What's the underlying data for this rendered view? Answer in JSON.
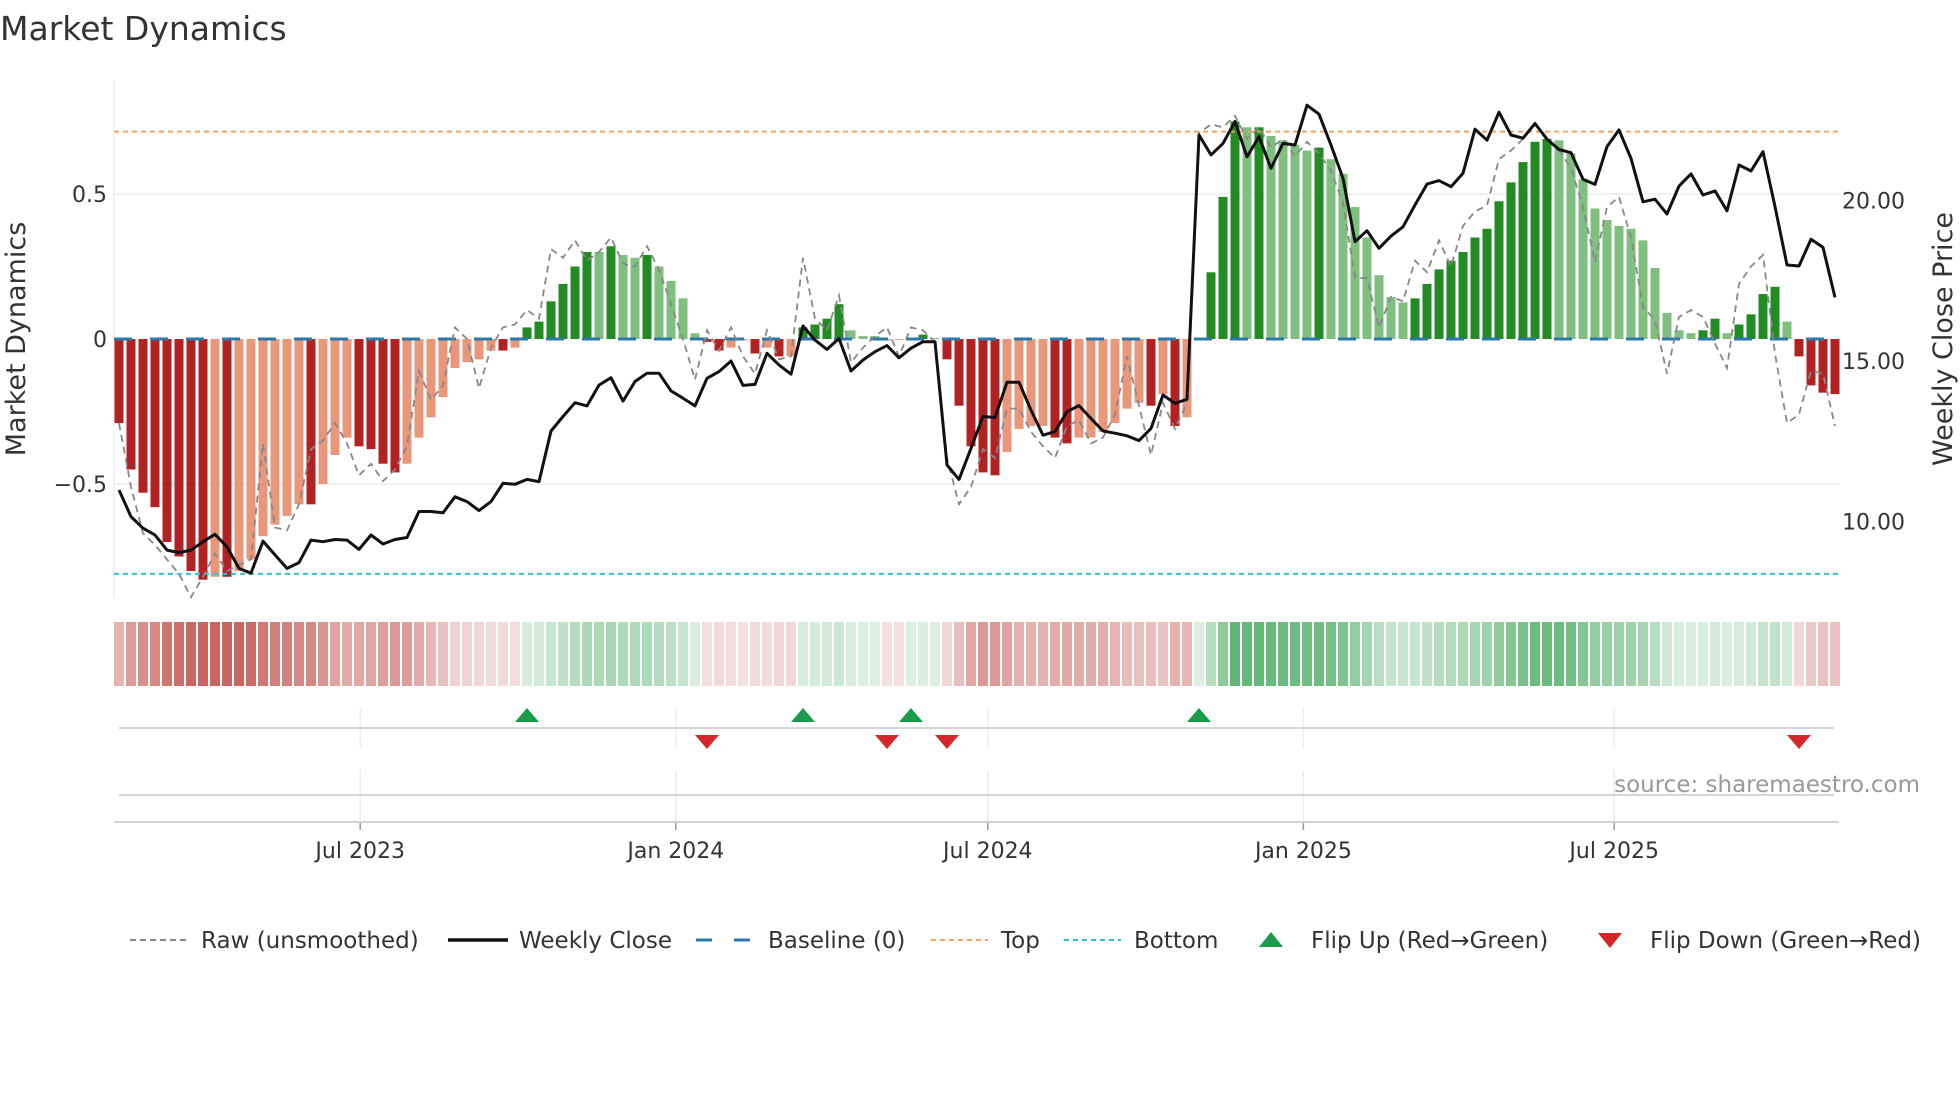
{
  "chart_data": {
    "type": "bar",
    "title": "Market Dynamics",
    "ylabel": "Market Dynamics",
    "y2label": "Weekly Close Price",
    "source": "source: sharemaestro.com",
    "ylim": [
      -0.93,
      0.85
    ],
    "y2lim": [
      7.6,
      23.8
    ],
    "yticks": [
      {
        "value": 0.5,
        "label": "0.5"
      },
      {
        "value": 0,
        "label": "0"
      },
      {
        "value": -0.5,
        "label": "−0.5"
      }
    ],
    "y2ticks": [
      {
        "value": 20,
        "label": "20.00"
      },
      {
        "value": 15,
        "label": "15.00"
      },
      {
        "value": 10,
        "label": "10.00"
      }
    ],
    "xticks": [
      {
        "week": 20.1,
        "label": "Jul 2023"
      },
      {
        "week": 46.4,
        "label": "Jan 2024"
      },
      {
        "week": 72.4,
        "label": "Jul 2024"
      },
      {
        "week": 98.7,
        "label": "Jan 2025"
      },
      {
        "week": 124.6,
        "label": "Jul 2025"
      }
    ],
    "top_level": 0.715,
    "bottom_level": -0.81,
    "baseline": 0,
    "colors": {
      "bar_red_strong": "#b22222",
      "bar_red_weak": "#e9967a",
      "bar_green_strong": "#228b22",
      "bar_green_weak": "#7fbf7f",
      "close": "#111111",
      "raw": "#888888",
      "baseline": "#2b78ab",
      "top": "#f4a460",
      "bottom": "#2cc5d8",
      "flip_up": "#1a9a4a",
      "flip_down": "#d62728"
    },
    "series": [
      {
        "name": "Market Dynamics (smoothed)",
        "values": [
          -0.29,
          -0.45,
          -0.53,
          -0.58,
          -0.7,
          -0.75,
          -0.8,
          -0.83,
          -0.82,
          -0.82,
          -0.8,
          -0.76,
          -0.68,
          -0.64,
          -0.61,
          -0.57,
          -0.57,
          -0.5,
          -0.4,
          -0.34,
          -0.37,
          -0.38,
          -0.43,
          -0.46,
          -0.43,
          -0.34,
          -0.27,
          -0.2,
          -0.1,
          -0.08,
          -0.07,
          -0.04,
          -0.04,
          -0.03,
          0.04,
          0.06,
          0.13,
          0.19,
          0.25,
          0.3,
          0.3,
          0.32,
          0.29,
          0.28,
          0.29,
          0.25,
          0.2,
          0.14,
          0.02,
          -0.01,
          -0.04,
          -0.03,
          -0.005,
          -0.05,
          -0.03,
          -0.06,
          -0.06,
          0.04,
          0.05,
          0.07,
          0.12,
          0.03,
          0.01,
          0.01,
          -0.005,
          -0.003,
          0.005,
          0.015,
          0.003,
          -0.07,
          -0.23,
          -0.37,
          -0.46,
          -0.47,
          -0.39,
          -0.31,
          -0.3,
          -0.3,
          -0.34,
          -0.36,
          -0.34,
          -0.34,
          -0.32,
          -0.29,
          -0.24,
          -0.22,
          -0.23,
          -0.19,
          -0.3,
          -0.27,
          0.005,
          0.23,
          0.49,
          0.75,
          0.73,
          0.73,
          0.7,
          0.685,
          0.67,
          0.65,
          0.66,
          0.62,
          0.57,
          0.455,
          0.35,
          0.22,
          0.145,
          0.126,
          0.14,
          0.19,
          0.24,
          0.27,
          0.3,
          0.35,
          0.38,
          0.475,
          0.54,
          0.61,
          0.68,
          0.69,
          0.685,
          0.64,
          0.55,
          0.45,
          0.41,
          0.39,
          0.38,
          0.34,
          0.245,
          0.09,
          0.03,
          0.02,
          0.03,
          0.07,
          0.02,
          0.05,
          0.085,
          0.155,
          0.18,
          0.06,
          -0.06,
          -0.16,
          -0.185,
          -0.19
        ],
        "strong": [
          1,
          1,
          1,
          1,
          1,
          1,
          1,
          1,
          0,
          1,
          0,
          0,
          0,
          0,
          0,
          0,
          1,
          0,
          0,
          0,
          1,
          1,
          1,
          1,
          0,
          0,
          0,
          0,
          0,
          0,
          0,
          0,
          1,
          0,
          1,
          1,
          1,
          1,
          1,
          1,
          0,
          1,
          0,
          0,
          1,
          0,
          0,
          0,
          0,
          1,
          1,
          0,
          0,
          1,
          0,
          1,
          0,
          1,
          1,
          1,
          1,
          0,
          0,
          0,
          0,
          0,
          0,
          1,
          0,
          1,
          1,
          1,
          1,
          1,
          0,
          0,
          0,
          0,
          1,
          1,
          0,
          0,
          0,
          0,
          0,
          0,
          1,
          0,
          1,
          0,
          0,
          1,
          1,
          1,
          0,
          1,
          0,
          0,
          0,
          0,
          1,
          0,
          0,
          0,
          0,
          0,
          0,
          0,
          1,
          1,
          1,
          1,
          1,
          1,
          1,
          1,
          1,
          1,
          1,
          1,
          0,
          0,
          0,
          0,
          0,
          0,
          0,
          0,
          0,
          0,
          0,
          0,
          1,
          1,
          0,
          1,
          1,
          1,
          1,
          0,
          1,
          1,
          1,
          1
        ]
      },
      {
        "name": "Raw (unsmoothed)",
        "values": [
          -0.29,
          -0.51,
          -0.67,
          -0.71,
          -0.76,
          -0.81,
          -0.89,
          -0.82,
          -0.74,
          -0.8,
          -0.78,
          -0.76,
          -0.36,
          -0.65,
          -0.66,
          -0.57,
          -0.38,
          -0.35,
          -0.29,
          -0.36,
          -0.47,
          -0.43,
          -0.49,
          -0.45,
          -0.37,
          -0.11,
          -0.21,
          -0.16,
          0.04,
          0.0,
          -0.17,
          -0.03,
          0.04,
          0.05,
          0.1,
          0.07,
          0.31,
          0.28,
          0.34,
          0.27,
          0.3,
          0.35,
          0.26,
          0.25,
          0.32,
          0.24,
          0.12,
          0.0,
          -0.14,
          0.03,
          -0.04,
          0.04,
          -0.06,
          -0.12,
          0.03,
          -0.07,
          -0.06,
          0.28,
          0.07,
          0.03,
          0.15,
          -0.08,
          -0.03,
          0.01,
          0.04,
          -0.06,
          0.04,
          0.03,
          -0.01,
          -0.41,
          -0.57,
          -0.51,
          -0.38,
          -0.41,
          -0.24,
          -0.24,
          -0.32,
          -0.37,
          -0.41,
          -0.3,
          -0.28,
          -0.36,
          -0.34,
          -0.26,
          -0.06,
          -0.23,
          -0.4,
          -0.22,
          -0.31,
          -0.22,
          0.71,
          0.74,
          0.73,
          0.77,
          0.69,
          0.73,
          0.66,
          0.69,
          0.63,
          0.68,
          0.64,
          0.58,
          0.47,
          0.21,
          0.21,
          0.04,
          0.145,
          0.13,
          0.27,
          0.23,
          0.34,
          0.25,
          0.39,
          0.44,
          0.46,
          0.62,
          0.65,
          0.69,
          0.74,
          0.69,
          0.65,
          0.59,
          0.455,
          0.265,
          0.455,
          0.49,
          0.35,
          0.11,
          0.065,
          -0.12,
          0.076,
          0.1,
          0.076,
          -0.016,
          -0.1,
          0.19,
          0.25,
          0.29,
          -0.05,
          -0.29,
          -0.26,
          -0.11,
          -0.12,
          -0.3
        ]
      },
      {
        "name": "Weekly Close",
        "values": [
          10.98,
          10.15,
          9.79,
          9.58,
          9.11,
          9.03,
          9.11,
          9.37,
          9.6,
          9.21,
          8.54,
          8.39,
          9.39,
          8.96,
          8.54,
          8.72,
          9.42,
          9.37,
          9.44,
          9.42,
          9.13,
          9.58,
          9.3,
          9.44,
          9.5,
          10.31,
          10.31,
          10.27,
          10.77,
          10.62,
          10.34,
          10.62,
          11.19,
          11.16,
          11.31,
          11.24,
          12.82,
          13.27,
          13.7,
          13.6,
          14.25,
          14.48,
          13.75,
          14.36,
          14.62,
          14.62,
          14.07,
          13.84,
          13.6,
          14.46,
          14.67,
          15.0,
          14.24,
          14.27,
          15.24,
          14.88,
          14.59,
          16.09,
          15.65,
          15.36,
          15.7,
          14.69,
          15.03,
          15.29,
          15.48,
          15.1,
          15.4,
          15.6,
          15.6,
          11.76,
          11.31,
          12.28,
          13.27,
          13.24,
          14.34,
          14.34,
          13.47,
          12.69,
          12.8,
          13.42,
          13.61,
          13.21,
          12.82,
          12.75,
          12.67,
          12.52,
          12.9,
          13.94,
          13.68,
          13.81,
          22.04,
          21.42,
          21.78,
          22.46,
          21.36,
          21.99,
          21.0,
          21.78,
          21.73,
          22.97,
          22.69,
          21.73,
          20.69,
          18.72,
          19.06,
          18.51,
          18.89,
          19.18,
          19.86,
          20.51,
          20.62,
          20.43,
          20.85,
          22.22,
          21.88,
          22.75,
          22.04,
          21.94,
          22.4,
          21.91,
          21.59,
          21.49,
          20.66,
          20.5,
          21.68,
          22.2,
          21.31,
          19.96,
          20.04,
          19.58,
          20.45,
          20.83,
          20.17,
          20.3,
          19.68,
          21.11,
          20.92,
          21.52,
          19.81,
          17.99,
          17.96,
          18.79,
          18.54,
          16.98
        ]
      }
    ],
    "flips_up_weeks": [
      34,
      57,
      66,
      90
    ],
    "flips_down_weeks": [
      49,
      64,
      69,
      140
    ],
    "legend": {
      "placement": "bottom",
      "items": [
        {
          "key": "raw",
          "label": "Raw (unsmoothed)"
        },
        {
          "key": "close",
          "label": "Weekly Close"
        },
        {
          "key": "baseline",
          "label": "Baseline (0)"
        },
        {
          "key": "top",
          "label": "Top"
        },
        {
          "key": "bottom",
          "label": "Bottom"
        },
        {
          "key": "flip_up",
          "label": "Flip Up (Red→Green)"
        },
        {
          "key": "flip_down",
          "label": "Flip Down (Green→Red)"
        }
      ]
    }
  }
}
